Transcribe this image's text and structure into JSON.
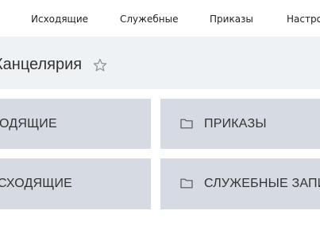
{
  "nav": {
    "items": [
      {
        "label": "Исходящие"
      },
      {
        "label": "Служебные"
      },
      {
        "label": "Приказы"
      },
      {
        "label": "Настро"
      }
    ]
  },
  "header": {
    "title": "Канцелярия",
    "favorite_icon": "star-outline-icon"
  },
  "tiles": [
    {
      "label": "ОДЯЩИЕ",
      "icon": null
    },
    {
      "label": "ПРИКАЗЫ",
      "icon": "folder-icon"
    },
    {
      "label": "СХОДЯЩИЕ",
      "icon": null
    },
    {
      "label": "СЛУЖЕБНЫЕ ЗАПИ",
      "icon": "folder-icon"
    }
  ],
  "colors": {
    "tile_bg": "#d6dbe3",
    "header_bg": "#eff2f5",
    "text": "#333333"
  }
}
